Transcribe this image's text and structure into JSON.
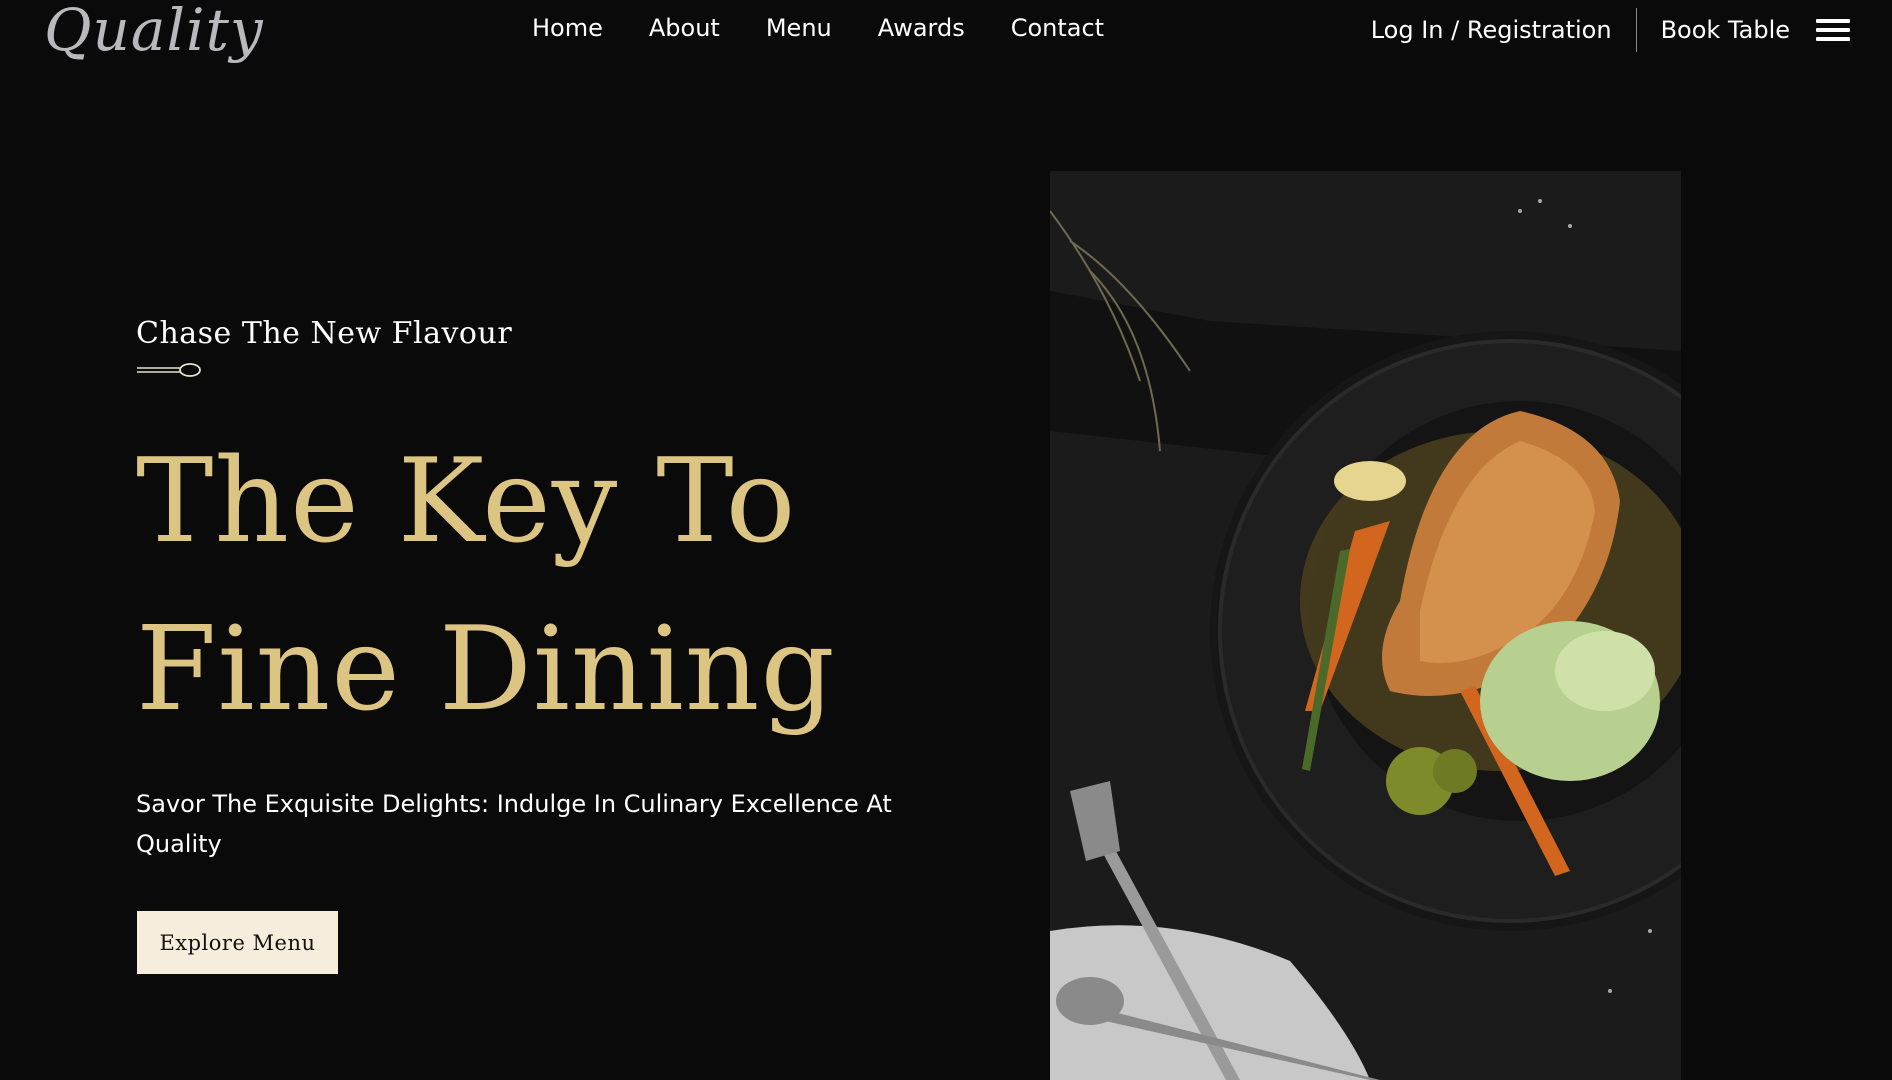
{
  "header": {
    "logo": "Quality",
    "nav": [
      {
        "label": "Home"
      },
      {
        "label": "About"
      },
      {
        "label": "Menu"
      },
      {
        "label": "Awards"
      },
      {
        "label": "Contact"
      }
    ],
    "login_label": "Log In / Registration",
    "book_label": "Book Table",
    "menu_icon": "hamburger-icon"
  },
  "hero": {
    "tagline": "Chase The New Flavour",
    "title_line1": "The Key To",
    "title_line2": "Fine Dining",
    "subtitle": "Savor The Exquisite Delights: Indulge In Culinary Excellence At Quality",
    "cta_label": "Explore Menu",
    "divider_icon": "spoon-icon"
  },
  "colors": {
    "background": "#0a0a0b",
    "accent_gold": "#dcc482",
    "button_bg": "#f6eddc"
  }
}
